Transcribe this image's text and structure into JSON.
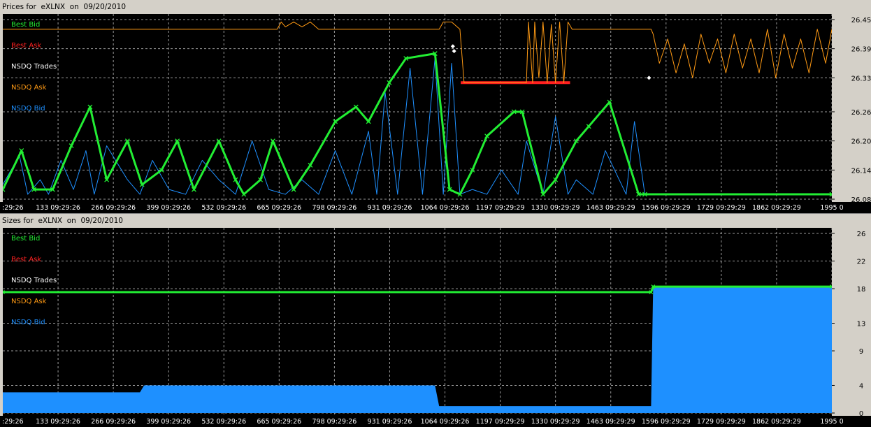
{
  "colors": {
    "best_bid": "#22ee33",
    "best_ask": "#ff2020",
    "nsdq_trades": "#ffffff",
    "nsdq_ask": "#ff9a14",
    "nsdq_bid": "#1e90ff",
    "grid": "#9a9a9a",
    "background": "#000000"
  },
  "prices_panel": {
    "title": "Prices for  eXLNX  on  09/20/2010",
    "legend": [
      "Best Bid",
      "Best Ask",
      "NSDQ Trades",
      "NSDQ Ask",
      "NSDQ Bid"
    ]
  },
  "sizes_panel": {
    "title": "Sizes for  eXLNX  on  09/20/2010",
    "legend": [
      "Best Bid",
      "Best Ask",
      "NSDQ Trades",
      "NSDQ Ask",
      "NSDQ Bid"
    ]
  },
  "chart_data": [
    {
      "type": "line",
      "title": "Prices for  eXLNX  on  09/20/2010",
      "xlabel": "",
      "ylabel": "",
      "x_tick_labels": [
        ":29:26",
        "133 09:29:26",
        "266 09:29:26",
        "399 09:29:26",
        "532 09:29:26",
        "665 09:29:26",
        "798 09:29:26",
        "931 09:29:26",
        "1064 09:29:26",
        "1197 09:29:29",
        "1330 09:29:29",
        "1463 09:29:29",
        "1596 09:29:29",
        "1729 09:29:29",
        "1862 09:29:29",
        "1995 0"
      ],
      "x_ticks": [
        0,
        133,
        266,
        399,
        532,
        665,
        798,
        931,
        1064,
        1197,
        1330,
        1463,
        1596,
        1729,
        1862,
        1995
      ],
      "xlim": [
        0,
        1995
      ],
      "y_tick_labels": [
        "26.08",
        "26.14",
        "26.20",
        "26.26",
        "26.33",
        "26.39",
        "26.45"
      ],
      "y_ticks": [
        26.08,
        26.14,
        26.2,
        26.26,
        26.33,
        26.39,
        26.45
      ],
      "ylim": [
        26.08,
        26.45
      ],
      "grid": true,
      "legend_position": "top-left",
      "series": [
        {
          "name": "Best Bid",
          "style": "line-with-x-markers",
          "x": [
            0,
            45,
            75,
            120,
            165,
            210,
            250,
            300,
            335,
            382,
            420,
            460,
            520,
            560,
            580,
            620,
            650,
            700,
            740,
            800,
            850,
            880,
            930,
            970,
            1040,
            1075,
            1100,
            1130,
            1165,
            1230,
            1250,
            1300,
            1330,
            1380,
            1410,
            1460,
            1530,
            1545,
            1995
          ],
          "y": [
            26.1,
            26.18,
            26.1,
            26.1,
            26.19,
            26.27,
            26.12,
            26.2,
            26.11,
            26.14,
            26.2,
            26.1,
            26.2,
            26.12,
            26.09,
            26.12,
            26.2,
            26.1,
            26.15,
            26.24,
            26.27,
            26.24,
            26.32,
            26.37,
            26.38,
            26.1,
            26.09,
            26.14,
            26.21,
            26.26,
            26.26,
            26.09,
            26.12,
            26.2,
            26.23,
            26.28,
            26.09,
            26.09,
            26.09
          ]
        },
        {
          "name": "Best Ask",
          "style": "line",
          "x": [
            1102,
            1270,
            1275,
            1365
          ],
          "y": [
            26.32,
            26.32,
            26.32,
            26.32
          ]
        },
        {
          "name": "NSDQ Trades",
          "style": "markers",
          "x": [
            1083,
            1086,
            1555
          ],
          "y": [
            26.395,
            26.385,
            26.33
          ]
        },
        {
          "name": "NSDQ Ask",
          "style": "line",
          "x": [
            0,
            660,
            670,
            680,
            700,
            720,
            740,
            760,
            1050,
            1060,
            1080,
            1100,
            1110,
            1260,
            1265,
            1275,
            1280,
            1290,
            1300,
            1310,
            1320,
            1330,
            1340,
            1350,
            1360,
            1370,
            1560,
            1565,
            1580,
            1600,
            1620,
            1640,
            1660,
            1680,
            1700,
            1720,
            1740,
            1760,
            1780,
            1800,
            1820,
            1840,
            1860,
            1880,
            1900,
            1920,
            1940,
            1960,
            1980,
            1995
          ],
          "y": [
            26.43,
            26.43,
            26.445,
            26.435,
            26.445,
            26.435,
            26.445,
            26.43,
            26.43,
            26.445,
            26.445,
            26.43,
            26.32,
            26.32,
            26.445,
            26.32,
            26.445,
            26.33,
            26.445,
            26.32,
            26.44,
            26.32,
            26.445,
            26.32,
            26.445,
            26.43,
            26.43,
            26.42,
            26.36,
            26.41,
            26.34,
            26.4,
            26.33,
            26.42,
            26.36,
            26.41,
            26.34,
            26.42,
            26.35,
            26.41,
            26.34,
            26.43,
            26.33,
            26.42,
            26.35,
            26.41,
            26.34,
            26.43,
            26.36,
            26.43
          ]
        },
        {
          "name": "NSDQ Bid",
          "style": "spike-line",
          "x": [
            0,
            40,
            60,
            90,
            110,
            140,
            170,
            200,
            220,
            250,
            300,
            330,
            360,
            400,
            440,
            480,
            520,
            560,
            600,
            640,
            680,
            720,
            760,
            800,
            840,
            880,
            900,
            920,
            950,
            980,
            1010,
            1040,
            1060,
            1080,
            1100,
            1130,
            1165,
            1200,
            1240,
            1260,
            1300,
            1330,
            1360,
            1380,
            1420,
            1450,
            1500,
            1520,
            1545,
            1995
          ],
          "y": [
            26.11,
            26.17,
            26.09,
            26.12,
            26.09,
            26.16,
            26.1,
            26.18,
            26.09,
            26.19,
            26.12,
            26.09,
            26.16,
            26.1,
            26.09,
            26.16,
            26.12,
            26.09,
            26.2,
            26.1,
            26.09,
            26.12,
            26.09,
            26.18,
            26.09,
            26.22,
            26.09,
            26.3,
            26.09,
            26.35,
            26.09,
            26.37,
            26.09,
            26.36,
            26.09,
            26.1,
            26.09,
            26.14,
            26.09,
            26.2,
            26.09,
            26.25,
            26.09,
            26.12,
            26.09,
            26.18,
            26.09,
            26.24,
            26.09,
            26.09
          ]
        }
      ]
    },
    {
      "type": "area",
      "title": "Sizes for  eXLNX  on  09/20/2010",
      "xlabel": "",
      "ylabel": "",
      "x_tick_labels": [
        ":29:26",
        "133 09:29:26",
        "266 09:29:26",
        "399 09:29:26",
        "532 09:29:26",
        "665 09:29:26",
        "798 09:29:26",
        "931 09:29:26",
        "1064 09:29:26",
        "1197 09:29:29",
        "1330 09:29:29",
        "1463 09:29:29",
        "1596 09:29:29",
        "1729 09:29:29",
        "1862 09:29:29",
        "1995 0"
      ],
      "x_ticks": [
        0,
        133,
        266,
        399,
        532,
        665,
        798,
        931,
        1064,
        1197,
        1330,
        1463,
        1596,
        1729,
        1862,
        1995
      ],
      "xlim": [
        0,
        1995
      ],
      "y_tick_labels": [
        "0",
        "4",
        "9",
        "13",
        "18",
        "22",
        "26"
      ],
      "y_ticks": [
        0,
        4,
        9,
        13,
        18,
        22,
        26
      ],
      "ylim": [
        0,
        26
      ],
      "grid": true,
      "legend_position": "top-left",
      "series": [
        {
          "name": "NSDQ Bid",
          "style": "area",
          "x": [
            0,
            330,
            340,
            1040,
            1050,
            1560,
            1565,
            1995
          ],
          "y": [
            3.0,
            3.0,
            4.0,
            4.0,
            1.0,
            1.0,
            18.3,
            18.3
          ]
        },
        {
          "name": "Best Bid",
          "style": "markers",
          "x": [
            0,
            1560,
            1565,
            1995
          ],
          "y": [
            17.5,
            17.5,
            18.3,
            18.3
          ]
        }
      ]
    }
  ]
}
